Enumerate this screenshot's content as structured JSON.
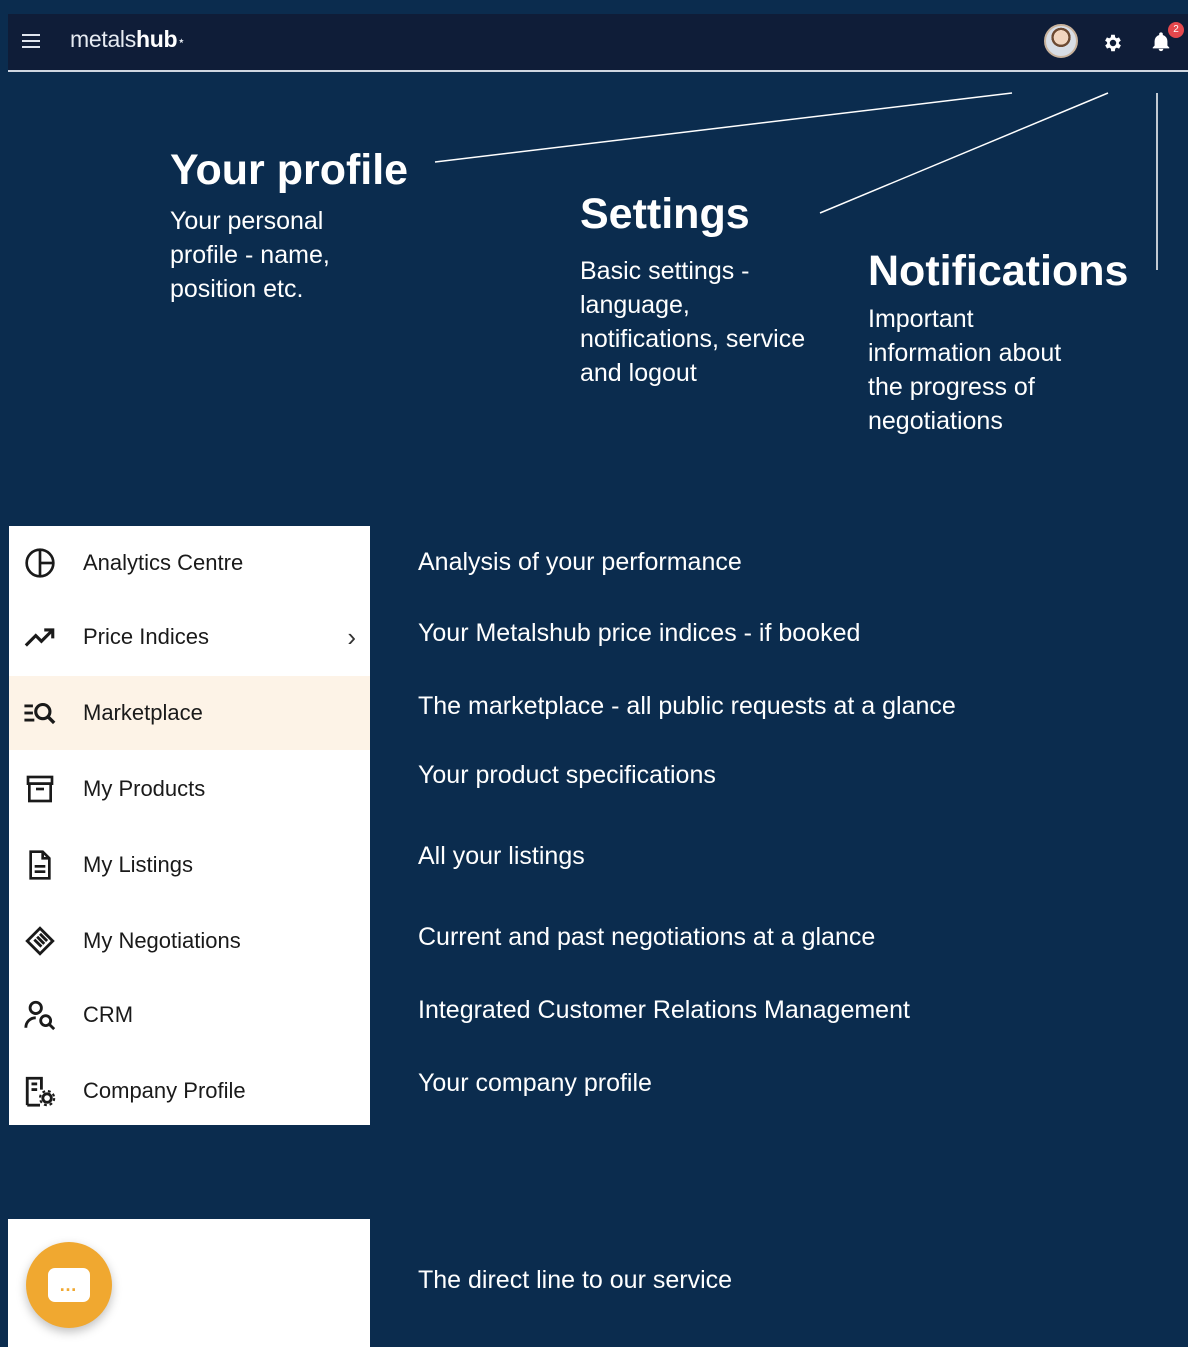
{
  "header": {
    "logo_light": "metals",
    "logo_bold": "hub",
    "notification_count": "2"
  },
  "annotations": {
    "profile": {
      "title": "Your profile",
      "lines": [
        "Your personal",
        "profile - name,",
        "position etc."
      ]
    },
    "settings": {
      "title": "Settings",
      "lines": [
        "Basic settings -",
        "language,",
        "notifications, service",
        "and logout"
      ]
    },
    "notifications": {
      "title": "Notifications",
      "lines": [
        "Important",
        "information about",
        "the progress of",
        "negotiations"
      ]
    }
  },
  "menu": {
    "items": [
      {
        "label": "Analytics Centre",
        "description": "Analysis of your performance",
        "icon": "pie-chart-icon"
      },
      {
        "label": "Price Indices",
        "description": "Your Metalshub price indices - if booked",
        "icon": "trend-up-icon"
      },
      {
        "label": "Marketplace",
        "description": "The marketplace - all public requests at a glance",
        "icon": "list-search-icon"
      },
      {
        "label": "My Products",
        "description": "Your product specifications",
        "icon": "archive-box-icon"
      },
      {
        "label": "My Listings",
        "description": "All your listings",
        "icon": "document-icon"
      },
      {
        "label": "My Negotiations",
        "description": "Current and past negotiations at a glance",
        "icon": "handshake-icon"
      },
      {
        "label": "CRM",
        "description": "Integrated Customer Relations Management",
        "icon": "user-search-icon"
      },
      {
        "label": "Company Profile",
        "description": "Your company profile",
        "icon": "building-gear-icon"
      }
    ],
    "active": "Marketplace"
  },
  "chat": {
    "description": "The direct line to our service",
    "icon": "chat-bubble-icon",
    "color": "#f0a830"
  },
  "colors": {
    "background": "#0b2c4e",
    "topbar": "#0f1d38",
    "active_item": "#fdf3e7"
  }
}
